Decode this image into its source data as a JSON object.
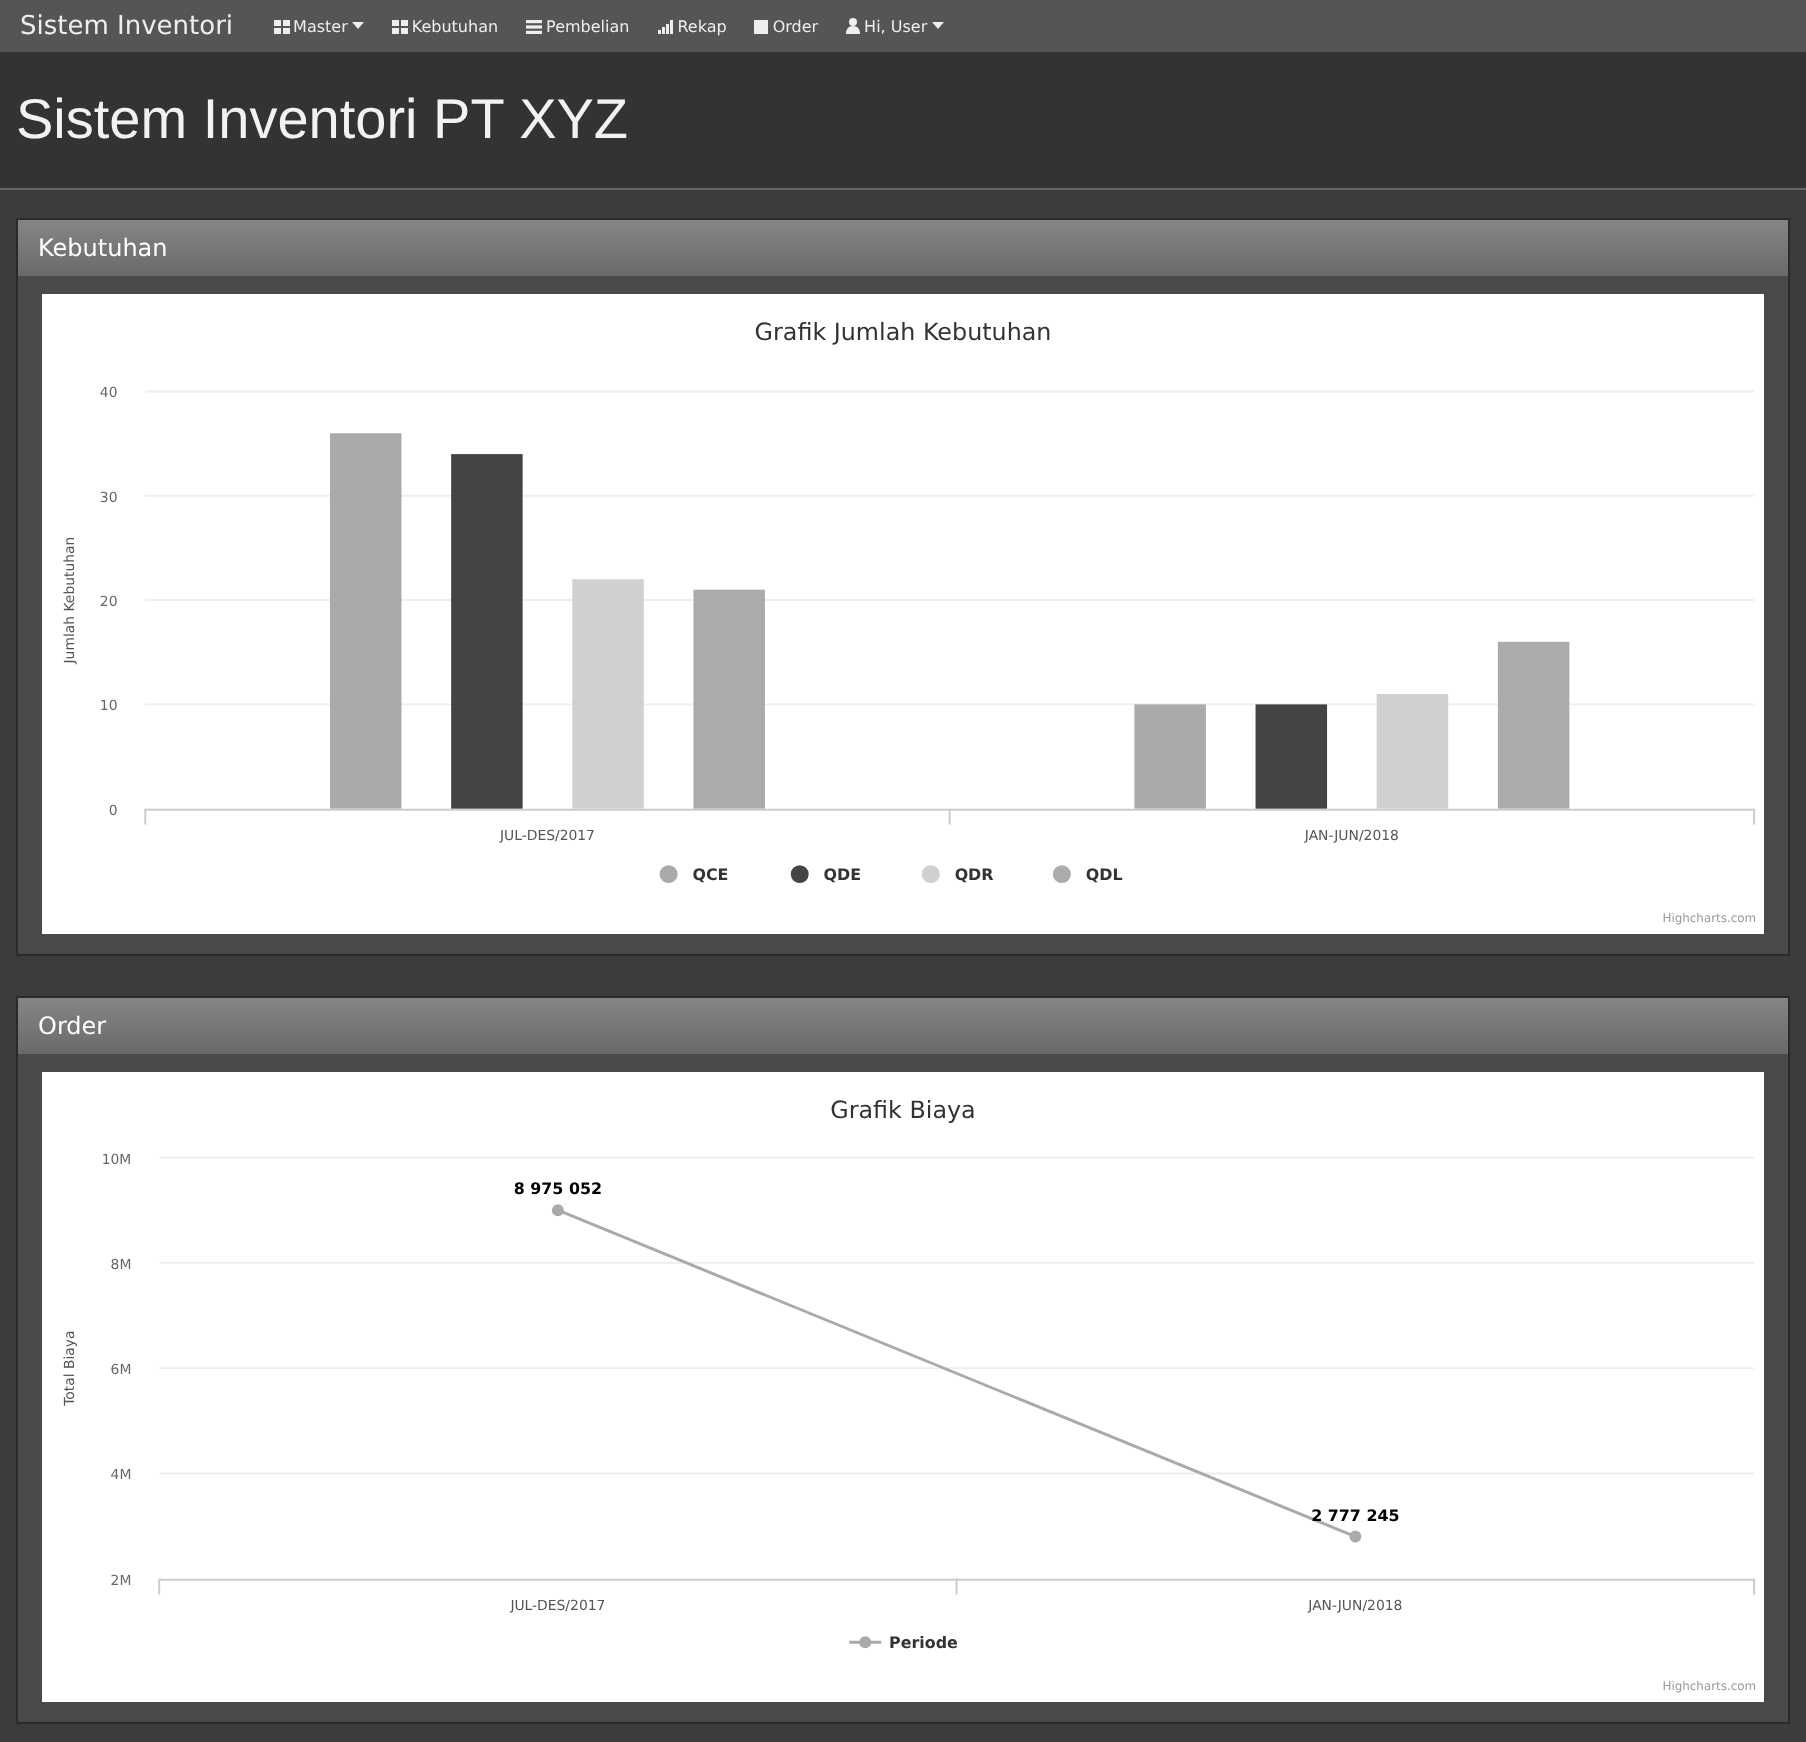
{
  "navbar": {
    "brand": "Sistem Inventori",
    "items": [
      {
        "label": "Master",
        "dropdown": true
      },
      {
        "label": "Kebutuhan",
        "dropdown": false
      },
      {
        "label": "Pembelian",
        "dropdown": false
      },
      {
        "label": "Rekap",
        "dropdown": false
      },
      {
        "label": "Order",
        "dropdown": false
      },
      {
        "label": "Hi, User",
        "dropdown": true
      }
    ]
  },
  "page_title": "Sistem Inventori PT XYZ",
  "panels": [
    {
      "heading": "Kebutuhan",
      "credit": "Highcharts.com",
      "chart_data": {
        "type": "bar",
        "title": "Grafik Jumlah Kebutuhan",
        "ylabel": "Jumlah Kebutuhan",
        "categories": [
          "JUL-DES/2017",
          "JAN-JUN/2018"
        ],
        "ylim": [
          0,
          40
        ],
        "yticks": [
          0,
          10,
          20,
          30,
          40
        ],
        "grid": true,
        "legend": "bottom",
        "series": [
          {
            "name": "QCE",
            "color": "#aaaaaa",
            "values": [
              36,
              10
            ]
          },
          {
            "name": "QDE",
            "color": "#444444",
            "values": [
              34,
              10
            ]
          },
          {
            "name": "QDR",
            "color": "#d0d0d0",
            "values": [
              22,
              11
            ]
          },
          {
            "name": "QDL",
            "color": "#ababab",
            "values": [
              21,
              16
            ]
          }
        ]
      }
    },
    {
      "heading": "Order",
      "credit": "Highcharts.com",
      "chart_data": {
        "type": "line",
        "title": "Grafik Biaya",
        "ylabel": "Total Biaya",
        "categories": [
          "JUL-DES/2017",
          "JAN-JUN/2018"
        ],
        "ylim": [
          2000000,
          10000000
        ],
        "yticks": [
          {
            "value": 2000000,
            "label": "2M"
          },
          {
            "value": 4000000,
            "label": "4M"
          },
          {
            "value": 6000000,
            "label": "6M"
          },
          {
            "value": 8000000,
            "label": "8M"
          },
          {
            "value": 10000000,
            "label": "10M"
          }
        ],
        "grid": true,
        "legend": "bottom",
        "value_labels": [
          "8 975 052",
          "2 777 245"
        ],
        "series": [
          {
            "name": "Periode",
            "color": "#aaaaaa",
            "marker": true,
            "values": [
              9000000,
              2800000
            ]
          }
        ]
      }
    }
  ]
}
